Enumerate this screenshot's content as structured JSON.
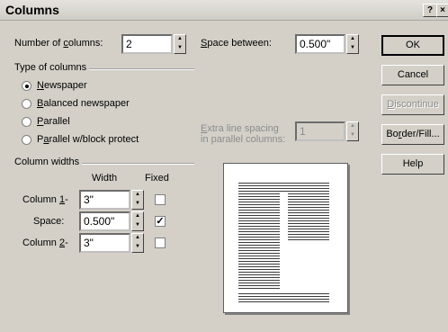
{
  "window": {
    "title": "Columns",
    "help_glyph": "?",
    "close_glyph": "×"
  },
  "number_of_columns": {
    "label_pre": "Number of ",
    "label_ul": "c",
    "label_post": "olumns:",
    "value": "2"
  },
  "space_between": {
    "label_ul": "S",
    "label_post": "pace between:",
    "value": "0.500\""
  },
  "type_of_columns": {
    "title": "Type of columns",
    "options": [
      {
        "ul": "N",
        "rest": "ewspaper",
        "selected": true
      },
      {
        "ul": "B",
        "rest": "alanced newspaper",
        "selected": false
      },
      {
        "ul": "P",
        "rest": "arallel",
        "selected": false
      },
      {
        "pre": "P",
        "ul": "a",
        "rest": "rallel w/block protect",
        "selected": false
      }
    ]
  },
  "extra_line_spacing": {
    "line1_ul": "E",
    "line1_rest": "xtra line spacing",
    "line2": "in parallel columns:",
    "value": "1"
  },
  "column_widths": {
    "title": "Column widths",
    "col_width": "Width",
    "col_fixed": "Fixed",
    "rows": [
      {
        "label_pre": "Column ",
        "label_ul": "1",
        "label_post": "-",
        "value": "3\"",
        "fixed": false
      },
      {
        "label_pre": "Space:",
        "label_ul": "",
        "label_post": "",
        "value": "0.500\"",
        "fixed": true
      },
      {
        "label_pre": "Column ",
        "label_ul": "2",
        "label_post": "-",
        "value": "3\"",
        "fixed": false
      }
    ]
  },
  "buttons": {
    "ok": "OK",
    "cancel": "Cancel",
    "discontinue_ul": "D",
    "discontinue_rest": "iscontinue",
    "border_pre": "Bo",
    "border_ul": "r",
    "border_rest": "der/Fill...",
    "help": "Help"
  },
  "colors": {
    "face": "#d4d0c8",
    "disabled_text": "#8c8c8c"
  }
}
